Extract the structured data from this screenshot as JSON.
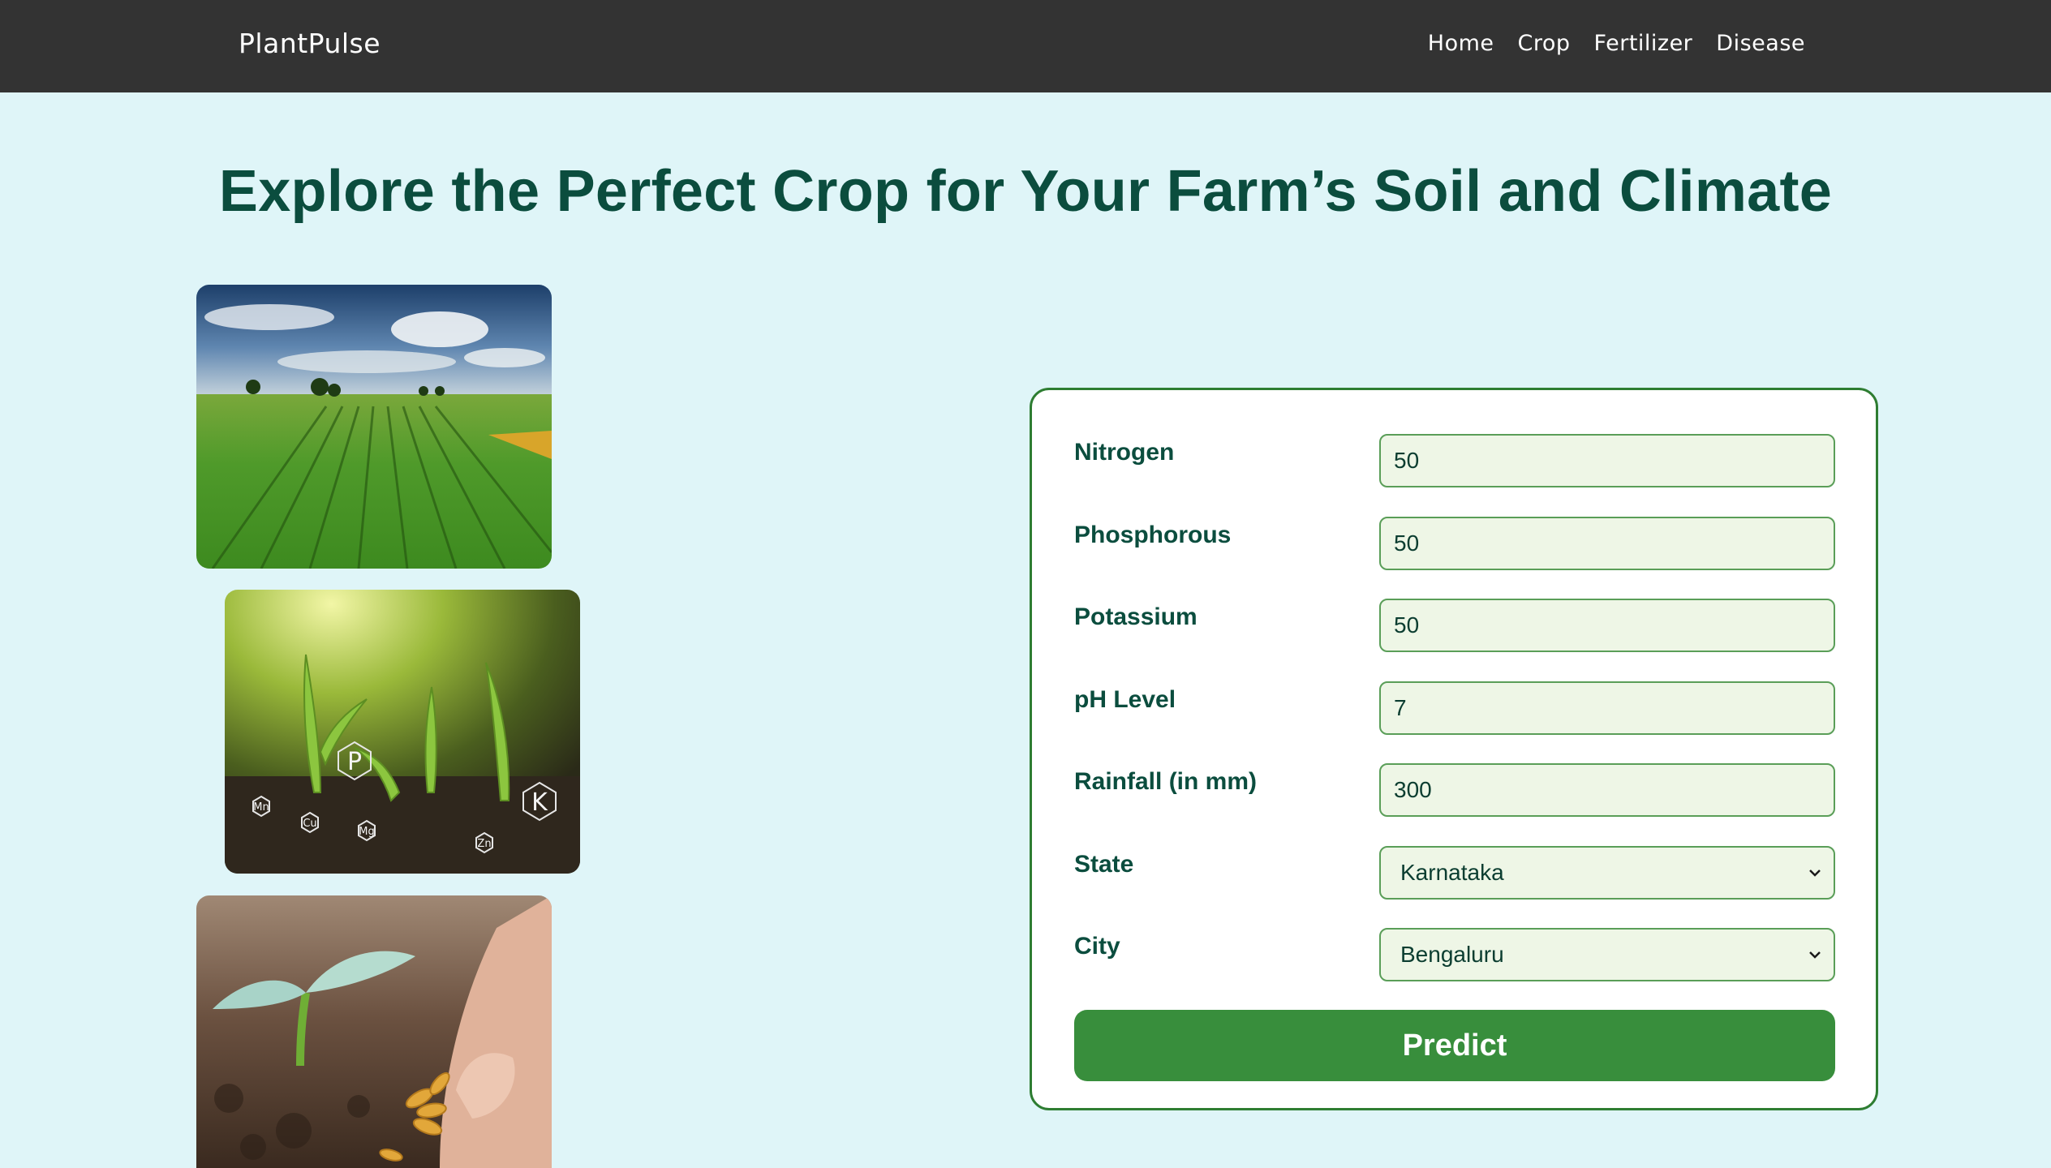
{
  "navbar": {
    "brand": "PlantPulse",
    "links": [
      "Home",
      "Crop",
      "Fertilizer",
      "Disease"
    ]
  },
  "page": {
    "title": "Explore the Perfect Crop for Your Farm’s Soil and Climate"
  },
  "images": {
    "photo_1": "farm-field-photo",
    "photo_2": "seedlings-nutrients-photo",
    "photo_3": "hand-planting-seed-photo",
    "nutrient_labels": [
      "P",
      "K",
      "Mn",
      "Cu",
      "Mg",
      "Zn"
    ]
  },
  "form": {
    "fields": [
      {
        "label": "Nitrogen",
        "value": "50"
      },
      {
        "label": "Phosphorous",
        "value": "50"
      },
      {
        "label": "Potassium",
        "value": "50"
      },
      {
        "label": "pH Level",
        "value": "7"
      },
      {
        "label": "Rainfall (in mm)",
        "value": "300"
      },
      {
        "label": "State",
        "value": "Karnataka"
      },
      {
        "label": "City",
        "value": "Bengaluru"
      }
    ],
    "submit_label": "Predict"
  },
  "colors": {
    "navbar": "#333333",
    "page_bg": "#dff5f8",
    "title": "#0b4d3e",
    "accent_green": "#388e3c",
    "input_bg": "#eef6e6"
  }
}
